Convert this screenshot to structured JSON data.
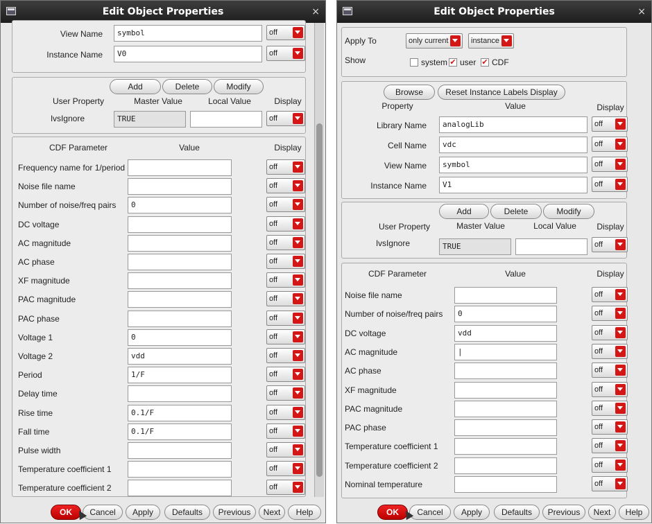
{
  "left": {
    "title": "Edit Object Properties",
    "close": "×",
    "instance_rows": [
      {
        "label": "View Name",
        "value": "symbol",
        "display": "off"
      },
      {
        "label": "Instance Name",
        "value": "V0",
        "display": "off"
      }
    ],
    "user_prop": {
      "add": "Add",
      "delete": "Delete",
      "modify": "Modify",
      "col_property": "User Property",
      "col_master": "Master Value",
      "col_local": "Local Value",
      "col_display": "Display",
      "row_label": "lvsIgnore",
      "row_master": "TRUE",
      "row_local": "",
      "row_display": "off"
    },
    "cdf": {
      "col_param": "CDF Parameter",
      "col_value": "Value",
      "col_display": "Display",
      "rows": [
        {
          "label": "Frequency name for 1/period",
          "value": "",
          "display": "off"
        },
        {
          "label": "Noise file name",
          "value": "",
          "display": "off"
        },
        {
          "label": "Number of noise/freq pairs",
          "value": "0",
          "display": "off"
        },
        {
          "label": "DC voltage",
          "value": "",
          "display": "off"
        },
        {
          "label": "AC magnitude",
          "value": "",
          "display": "off"
        },
        {
          "label": "AC phase",
          "value": "",
          "display": "off"
        },
        {
          "label": "XF magnitude",
          "value": "",
          "display": "off"
        },
        {
          "label": "PAC magnitude",
          "value": "",
          "display": "off"
        },
        {
          "label": "PAC phase",
          "value": "",
          "display": "off"
        },
        {
          "label": "Voltage 1",
          "value": "0",
          "display": "off"
        },
        {
          "label": "Voltage 2",
          "value": "vdd",
          "display": "off"
        },
        {
          "label": "Period",
          "value": "1/F",
          "display": "off"
        },
        {
          "label": "Delay time",
          "value": "",
          "display": "off"
        },
        {
          "label": "Rise time",
          "value": "0.1/F",
          "display": "off"
        },
        {
          "label": "Fall time",
          "value": "0.1/F",
          "display": "off"
        },
        {
          "label": "Pulse width",
          "value": "",
          "display": "off"
        },
        {
          "label": "Temperature coefficient 1",
          "value": "",
          "display": "off"
        },
        {
          "label": "Temperature coefficient 2",
          "value": "",
          "display": "off"
        }
      ]
    },
    "buttons": {
      "ok": "OK",
      "cancel": "Cancel",
      "apply": "Apply",
      "defaults": "Defaults",
      "previous": "Previous",
      "next": "Next",
      "help": "Help"
    }
  },
  "right": {
    "title": "Edit Object Properties",
    "close": "×",
    "apply_to": {
      "label": "Apply To",
      "scope": "only current",
      "target": "instance"
    },
    "show": {
      "label": "Show",
      "system": "system",
      "user": "user",
      "cdf": "CDF",
      "user_checked": "✔",
      "cdf_checked": "✔"
    },
    "instance": {
      "browse": "Browse",
      "reset": "Reset Instance Labels Display",
      "col_property": "Property",
      "col_value": "Value",
      "col_display": "Display",
      "rows": [
        {
          "label": "Library Name",
          "value": "analogLib",
          "display": "off"
        },
        {
          "label": "Cell Name",
          "value": "vdc",
          "display": "off"
        },
        {
          "label": "View Name",
          "value": "symbol",
          "display": "off"
        },
        {
          "label": "Instance Name",
          "value": "V1",
          "display": "off"
        }
      ]
    },
    "user_prop": {
      "add": "Add",
      "delete": "Delete",
      "modify": "Modify",
      "col_property": "User Property",
      "col_master": "Master Value",
      "col_local": "Local Value",
      "col_display": "Display",
      "row_label": "lvsIgnore",
      "row_master": "TRUE",
      "row_local": "",
      "row_display": "off"
    },
    "cdf": {
      "col_param": "CDF Parameter",
      "col_value": "Value",
      "col_display": "Display",
      "rows": [
        {
          "label": "Noise file name",
          "value": "",
          "display": "off"
        },
        {
          "label": "Number of noise/freq pairs",
          "value": "0",
          "display": "off"
        },
        {
          "label": "DC voltage",
          "value": "vdd",
          "display": "off"
        },
        {
          "label": "AC magnitude",
          "value": "|",
          "display": "off"
        },
        {
          "label": "AC phase",
          "value": "",
          "display": "off"
        },
        {
          "label": "XF magnitude",
          "value": "",
          "display": "off"
        },
        {
          "label": "PAC magnitude",
          "value": "",
          "display": "off"
        },
        {
          "label": "PAC phase",
          "value": "",
          "display": "off"
        },
        {
          "label": "Temperature coefficient 1",
          "value": "",
          "display": "off"
        },
        {
          "label": "Temperature coefficient 2",
          "value": "",
          "display": "off"
        },
        {
          "label": "Nominal temperature",
          "value": "",
          "display": "off"
        }
      ]
    },
    "buttons": {
      "ok": "OK",
      "cancel": "Cancel",
      "apply": "Apply",
      "defaults": "Defaults",
      "previous": "Previous",
      "next": "Next",
      "help": "Help"
    }
  }
}
